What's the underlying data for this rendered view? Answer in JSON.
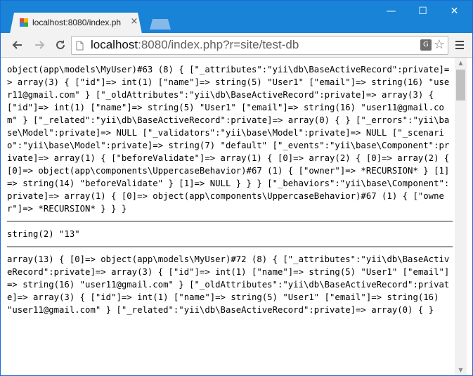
{
  "browser": {
    "tab_title": "localhost:8080/index.ph",
    "tab_close": "×",
    "window_controls": {
      "minimize": "—",
      "maximize": "☐",
      "close": "✕"
    },
    "url_host": "localhost",
    "url_rest": ":8080/index.php?r=site/test-db",
    "translate_glyph": "G",
    "icons": [
      "back-icon",
      "forward-icon",
      "reload-icon",
      "page-icon",
      "translate-icon",
      "star-icon",
      "menu-icon"
    ]
  },
  "page": {
    "dump_1": "object(app\\models\\MyUser)#63 (8) { [\"_attributes\":\"yii\\db\\BaseActiveRecord\":private]=> array(3) { [\"id\"]=> int(1) [\"name\"]=> string(5) \"User1\" [\"email\"]=> string(16) \"user11@gmail.com\" } [\"_oldAttributes\":\"yii\\db\\BaseActiveRecord\":private]=> array(3) { [\"id\"]=> int(1) [\"name\"]=> string(5) \"User1\" [\"email\"]=> string(16) \"user11@gmail.com\" } [\"_related\":\"yii\\db\\BaseActiveRecord\":private]=> array(0) { } [\"_errors\":\"yii\\base\\Model\":private]=> NULL [\"_validators\":\"yii\\base\\Model\":private]=> NULL [\"_scenario\":\"yii\\base\\Model\":private]=> string(7) \"default\" [\"_events\":\"yii\\base\\Component\":private]=> array(1) { [\"beforeValidate\"]=> array(1) { [0]=> array(2) { [0]=> array(2) { [0]=> object(app\\components\\UppercaseBehavior)#67 (1) { [\"owner\"]=> *RECURSION* } [1]=> string(14) \"beforeValidate\" } [1]=> NULL } } } [\"_behaviors\":\"yii\\base\\Component\":private]=> array(1) { [0]=> object(app\\components\\UppercaseBehavior)#67 (1) { [\"owner\"]=> *RECURSION* } } }",
    "dump_2": "string(2) \"13\"",
    "dump_3": "array(13) { [0]=> object(app\\models\\MyUser)#72 (8) { [\"_attributes\":\"yii\\db\\BaseActiveRecord\":private]=> array(3) { [\"id\"]=> int(1) [\"name\"]=> string(5) \"User1\" [\"email\"]=> string(16) \"user11@gmail.com\" } [\"_oldAttributes\":\"yii\\db\\BaseActiveRecord\":private]=> array(3) { [\"id\"]=> int(1) [\"name\"]=> string(5) \"User1\" [\"email\"]=> string(16) \"user11@gmail.com\" } [\"_related\":\"yii\\db\\BaseActiveRecord\":private]=> array(0) { }"
  },
  "colors": {
    "titlebar": "#1883d7",
    "tab": "#f2f2f2",
    "separator": "#9a9a9a"
  }
}
